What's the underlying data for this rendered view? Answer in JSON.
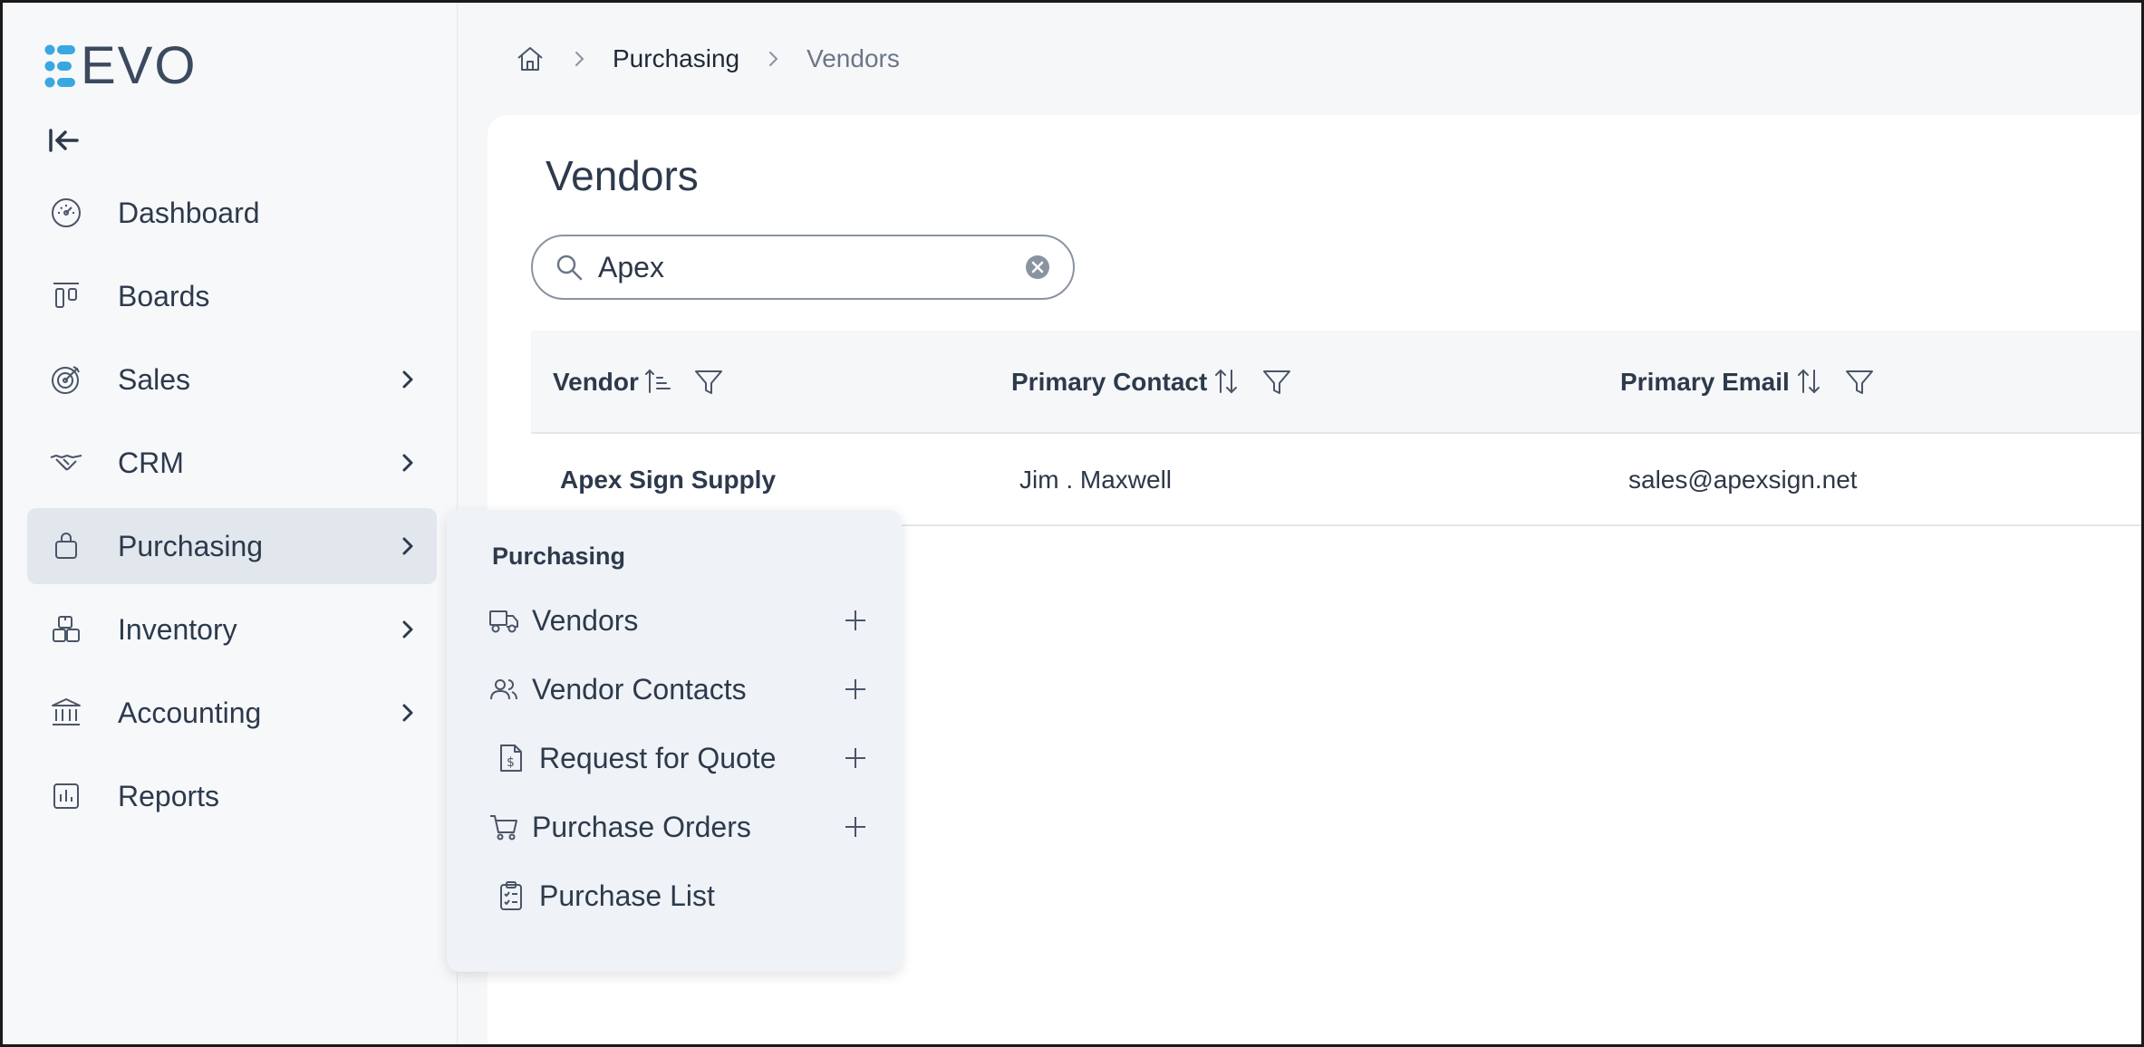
{
  "app": {
    "logo_text": "EVO"
  },
  "sidebar": {
    "items": [
      {
        "label": "Dashboard",
        "icon": "gauge-icon",
        "has_chevron": false
      },
      {
        "label": "Boards",
        "icon": "board-icon",
        "has_chevron": false
      },
      {
        "label": "Sales",
        "icon": "target-icon",
        "has_chevron": true
      },
      {
        "label": "CRM",
        "icon": "handshake-icon",
        "has_chevron": true
      },
      {
        "label": "Purchasing",
        "icon": "shopping-bag-icon",
        "has_chevron": true,
        "active": true
      },
      {
        "label": "Inventory",
        "icon": "boxes-icon",
        "has_chevron": true
      },
      {
        "label": "Accounting",
        "icon": "bank-icon",
        "has_chevron": true
      },
      {
        "label": "Reports",
        "icon": "bar-chart-icon",
        "has_chevron": false
      }
    ]
  },
  "breadcrumb": {
    "items": [
      "Purchasing",
      "Vendors"
    ]
  },
  "page": {
    "title": "Vendors"
  },
  "search": {
    "value": "Apex"
  },
  "table": {
    "columns": [
      "Vendor",
      "Primary Contact",
      "Primary Email"
    ],
    "rows": [
      {
        "vendor": "Apex Sign Supply",
        "contact": "Jim . Maxwell",
        "email": "sales@apexsign.net"
      }
    ]
  },
  "flyout": {
    "title": "Purchasing",
    "items": [
      {
        "label": "Vendors",
        "icon": "truck-icon",
        "has_plus": true
      },
      {
        "label": "Vendor Contacts",
        "icon": "users-icon",
        "has_plus": true
      },
      {
        "label": "Request for Quote",
        "icon": "invoice-icon",
        "has_plus": true
      },
      {
        "label": "Purchase Orders",
        "icon": "cart-icon",
        "has_plus": true
      },
      {
        "label": "Purchase List",
        "icon": "clipboard-list-icon",
        "has_plus": false
      }
    ]
  },
  "colors": {
    "accent_blue": "#3aa8e0",
    "text_dark": "#2d3a4c",
    "active_bg": "#e2e7ee"
  }
}
